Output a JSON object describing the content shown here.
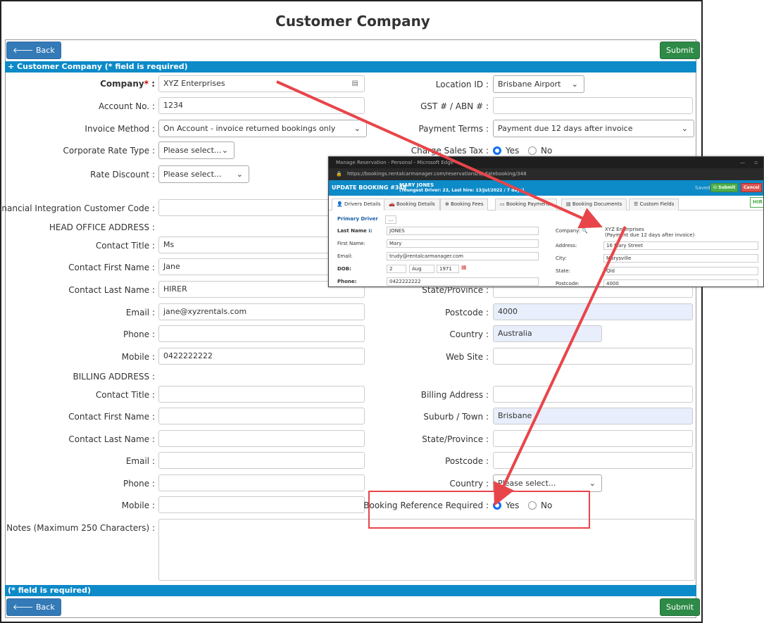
{
  "page_title": "Customer Company",
  "buttons": {
    "back": "🡐 Back",
    "submit": "Submit"
  },
  "section_bar": "+ Customer Company (* field is required)",
  "footer_bar": "(* field is required)",
  "left": {
    "company_label": "Company",
    "company_req": "*",
    "company_colon": " :",
    "company_value": "XYZ Enterprises",
    "account_label": "Account No. :",
    "account_value": "1234",
    "invoice_label": "Invoice Method :",
    "invoice_value": "On Account - invoice returned bookings only",
    "corp_rate_label": "Corporate Rate Type :",
    "corp_rate_value": "Please select...",
    "rate_discount_label": "Rate Discount :",
    "rate_discount_value": "Please select...",
    "fin_code_label": "Financial Integration Customer Code :",
    "head_office_label": "HEAD OFFICE ADDRESS :",
    "contact_title_label": "Contact Title :",
    "contact_title_value": "Ms",
    "contact_first_label": "Contact First Name :",
    "contact_first_value": "Jane",
    "contact_last_label": "Contact Last Name :",
    "contact_last_value": "HIRER",
    "email_label": "Email :",
    "email_value": "jane@xyzrentals.com",
    "phone_label": "Phone :",
    "mobile_label": "Mobile :",
    "mobile_value": "0422222222",
    "billing_address_label": "BILLING ADDRESS :",
    "b_contact_title_label": "Contact Title :",
    "b_contact_first_label": "Contact First Name :",
    "b_contact_last_label": "Contact Last Name :",
    "b_email_label": "Email :",
    "b_phone_label": "Phone :",
    "b_mobile_label": "Mobile :",
    "notes_label": "Notes (Maximum 250 Characters) :"
  },
  "right": {
    "location_label": "Location ID :",
    "location_value": "Brisbane Airport",
    "gst_label": "GST # / ABN # :",
    "payment_terms_label": "Payment Terms :",
    "payment_terms_value": "Payment due 12 days after invoice",
    "charge_tax_label": "Charge Sales Tax :",
    "yes": "Yes",
    "no": "No",
    "state_label": "State/Province :",
    "postcode_label": "Postcode :",
    "postcode_value": "4000",
    "country_label": "Country :",
    "country_value": "Australia",
    "website_label": "Web Site :",
    "billing_addr_label": "Billing Address :",
    "suburb_label": "Suburb / Town :",
    "suburb_value": "Brisbane",
    "b_state_label": "State/Province :",
    "b_postcode_label": "Postcode :",
    "b_country_label": "Country :",
    "b_country_value": "Please select...",
    "booking_ref_label": "Booking Reference Required :"
  },
  "overlay": {
    "window_title": "Manage Reservation - Personal - Microsoft Edge",
    "url": "https://bookings.rentalcarmanager.com/reservations/updatebooking/348",
    "heading": "UPDATE BOOKING #348",
    "customer_name": "MARY JONES",
    "customer_sub": "(Youngest Driver: 23, Last hire: 13/Jul/2022 / 7 days)",
    "saved": "Saved",
    "submit": "Submit",
    "cancel": "Cancel",
    "hire": "HIR",
    "tabs": [
      "Drivers Details",
      "Booking Details",
      "Booking Fees",
      "Booking Payments",
      "Booking Documents",
      "Custom Fields"
    ],
    "primary_driver": "Primary Driver",
    "dots": "...",
    "last_name_label": "Last Name",
    "last_name_value": "JONES",
    "first_name_label": "First Name:",
    "first_name_value": "Mary",
    "email_label": "Email:",
    "email_value": "trudy@rentalcarmanager.com",
    "dob_label": "DOB:",
    "dob_day": "2",
    "dob_month": "Aug",
    "dob_year": "1971",
    "phone_label": "Phone:",
    "phone_value": "0422222222",
    "company_label": "Company:",
    "company_value": "XYZ Enterprises",
    "company_terms": "(Payment due 12 days after invoice)",
    "address_label": "Address:",
    "address_value": "16 Mary Street",
    "city_label": "City:",
    "city_value": "Marysville",
    "state_label": "State:",
    "state_value": "Qld",
    "postcode_label": "Postcode:",
    "postcode_value": "4000"
  },
  "colors": {
    "accent_blue": "#0d8ac8",
    "submit_green": "#2e8b47",
    "back_blue": "#337ab7",
    "arrow_red": "#e8454a"
  }
}
